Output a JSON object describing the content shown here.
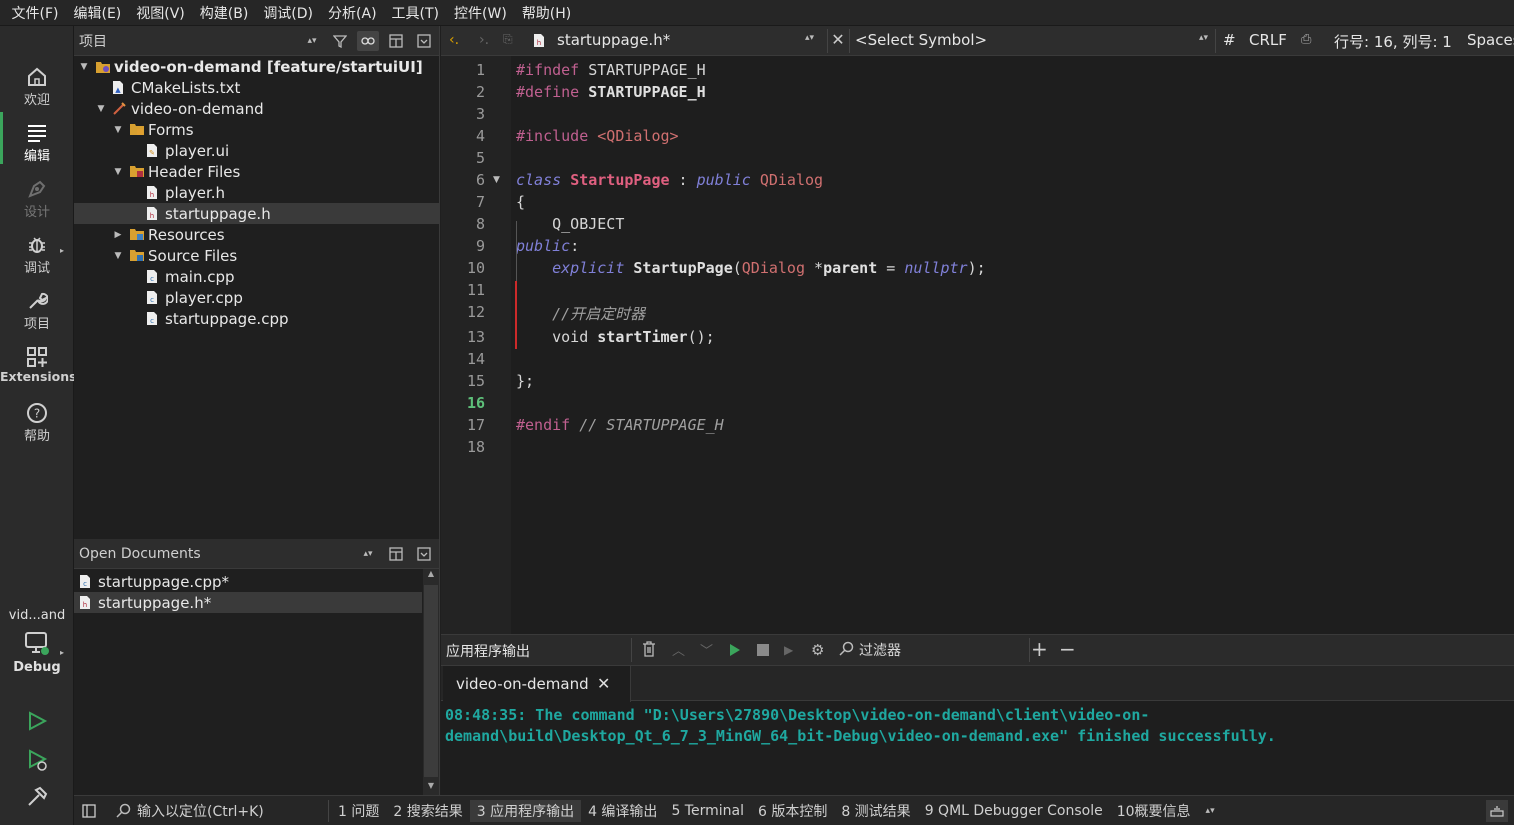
{
  "menubar": [
    "文件(F)",
    "编辑(E)",
    "视图(V)",
    "构建(B)",
    "调试(D)",
    "分析(A)",
    "工具(T)",
    "控件(W)",
    "帮助(H)"
  ],
  "modes": {
    "welcome": "欢迎",
    "edit": "编辑",
    "design": "设计",
    "debug": "调试",
    "projects": "项目",
    "extensions": "Extensions",
    "help": "帮助",
    "target_name": "vid...and",
    "build_config": "Debug"
  },
  "project_pane": {
    "title": "项目",
    "tree": [
      {
        "label": "video-on-demand [feature/startuiUI]",
        "indent": 0,
        "arrow": "down",
        "icon": "project-icon",
        "bold": true
      },
      {
        "label": "CMakeLists.txt",
        "indent": 1,
        "arrow": "",
        "icon": "cmake-file-icon"
      },
      {
        "label": "video-on-demand",
        "indent": 1,
        "arrow": "down",
        "icon": "subproject-icon"
      },
      {
        "label": "Forms",
        "indent": 2,
        "arrow": "down",
        "icon": "forms-folder-icon"
      },
      {
        "label": "player.ui",
        "indent": 3,
        "arrow": "",
        "icon": "ui-file-icon"
      },
      {
        "label": "Header Files",
        "indent": 2,
        "arrow": "down",
        "icon": "header-folder-icon"
      },
      {
        "label": "player.h",
        "indent": 3,
        "arrow": "",
        "icon": "header-file-icon"
      },
      {
        "label": "startuppage.h",
        "indent": 3,
        "arrow": "",
        "icon": "header-file-icon",
        "selected": true
      },
      {
        "label": "Resources",
        "indent": 2,
        "arrow": "right",
        "icon": "resources-folder-icon"
      },
      {
        "label": "Source Files",
        "indent": 2,
        "arrow": "down",
        "icon": "source-folder-icon"
      },
      {
        "label": "main.cpp",
        "indent": 3,
        "arrow": "",
        "icon": "cpp-file-icon"
      },
      {
        "label": "player.cpp",
        "indent": 3,
        "arrow": "",
        "icon": "cpp-file-icon"
      },
      {
        "label": "startuppage.cpp",
        "indent": 3,
        "arrow": "",
        "icon": "cpp-file-icon"
      }
    ]
  },
  "open_documents": {
    "title": "Open Documents",
    "items": [
      {
        "label": "startuppage.cpp*",
        "icon": "cpp-file-icon"
      },
      {
        "label": "startuppage.h*",
        "icon": "header-file-icon",
        "selected": true
      }
    ]
  },
  "editor_toolbar": {
    "file": "startuppage.h*",
    "symbol": "<Select Symbol>",
    "hash": "#",
    "line_ending": "CRLF",
    "position": "行号: 16, 列号: 1",
    "indent": "Spaces"
  },
  "code": {
    "current_line": 16,
    "lines": [
      [
        {
          "t": "#ifndef ",
          "c": "pp"
        },
        {
          "t": "STARTUPPAGE_H",
          "c": ""
        }
      ],
      [
        {
          "t": "#define ",
          "c": "pp"
        },
        {
          "t": "STARTUPPAGE_H",
          "c": "fn"
        }
      ],
      [],
      [
        {
          "t": "#include ",
          "c": "pp"
        },
        {
          "t": "<QDialog>",
          "c": "str"
        }
      ],
      [],
      [
        {
          "t": "class ",
          "c": "kw"
        },
        {
          "t": "StartupPage",
          "c": "cls"
        },
        {
          "t": " : ",
          "c": ""
        },
        {
          "t": "public ",
          "c": "kw"
        },
        {
          "t": "QDialog",
          "c": "str"
        }
      ],
      [
        {
          "t": "{",
          "c": ""
        }
      ],
      [
        {
          "t": "    Q_OBJECT",
          "c": ""
        }
      ],
      [
        {
          "t": "public",
          "c": "kw"
        },
        {
          "t": ":",
          "c": ""
        }
      ],
      [
        {
          "t": "    ",
          "c": ""
        },
        {
          "t": "explicit ",
          "c": "kw"
        },
        {
          "t": "StartupPage",
          "c": "fn"
        },
        {
          "t": "(",
          "c": ""
        },
        {
          "t": "QDialog",
          "c": "str"
        },
        {
          "t": " *",
          "c": ""
        },
        {
          "t": "parent",
          "c": "fn"
        },
        {
          "t": " = ",
          "c": ""
        },
        {
          "t": "nullptr",
          "c": "null"
        },
        {
          "t": ");",
          "c": ""
        }
      ],
      [],
      [
        {
          "t": "    //开启定时器",
          "c": "cm"
        }
      ],
      [
        {
          "t": "    void ",
          "c": ""
        },
        {
          "t": "startTimer",
          "c": "fn"
        },
        {
          "t": "();",
          "c": ""
        }
      ],
      [],
      [
        {
          "t": "};",
          "c": ""
        }
      ],
      [],
      [
        {
          "t": "#endif ",
          "c": "pp"
        },
        {
          "t": "// STARTUPPAGE_H",
          "c": "cm"
        }
      ],
      []
    ]
  },
  "output_pane": {
    "title": "应用程序输出",
    "filter_placeholder": "过滤器",
    "tab": "video-on-demand",
    "text_line1": "08:48:35: The command \"D:\\Users\\27890\\Desktop\\video-on-demand\\client\\video-on-",
    "text_line2": "demand\\build\\Desktop_Qt_6_7_3_MinGW_64_bit-Debug\\video-on-demand.exe\" finished successfully."
  },
  "statusbar": {
    "locator_placeholder": "输入以定位(Ctrl+K)",
    "tabs": [
      "1 问题",
      "2 搜索结果",
      "3 应用程序输出",
      "4 编译输出",
      "5 Terminal",
      "6 版本控制",
      "8 测试结果",
      "9 QML Debugger Console",
      "10概要信息"
    ],
    "active_tab": 2
  },
  "colors": {
    "accent_green": "#3ba55c",
    "output_text": "#1fa8a0",
    "keyword": "#8080d8",
    "class_name": "#e06080"
  }
}
